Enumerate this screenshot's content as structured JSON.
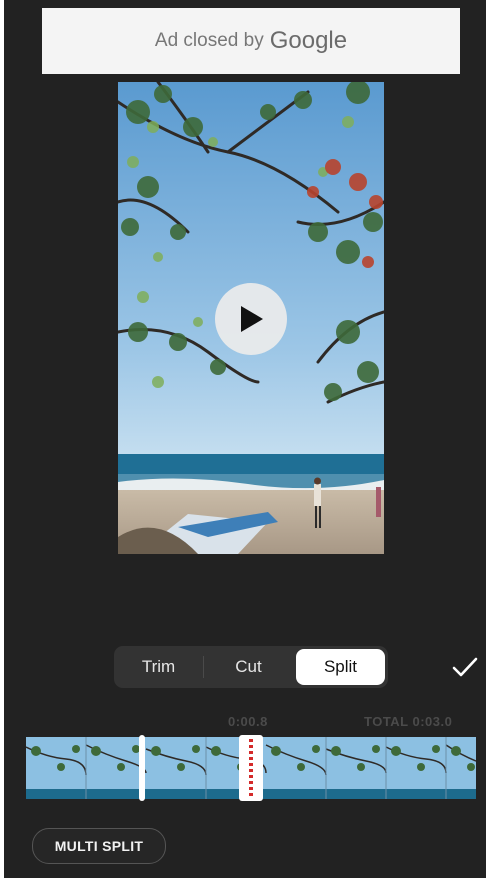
{
  "ad": {
    "text": "Ad closed by",
    "brand": "Google"
  },
  "editor": {
    "tabs": [
      {
        "label": "Trim",
        "active": false
      },
      {
        "label": "Cut",
        "active": false
      },
      {
        "label": "Split",
        "active": true
      }
    ],
    "current_time": "0:00.8",
    "total_time": "TOTAL 0:03.0",
    "multi_split_label": "MULTI SPLIT"
  },
  "colors": {
    "background": "#222222",
    "accent_split": "#d42a2a",
    "active_tab": "#ffffff"
  },
  "icons": {
    "play": "play-icon",
    "done": "checkmark-icon"
  }
}
